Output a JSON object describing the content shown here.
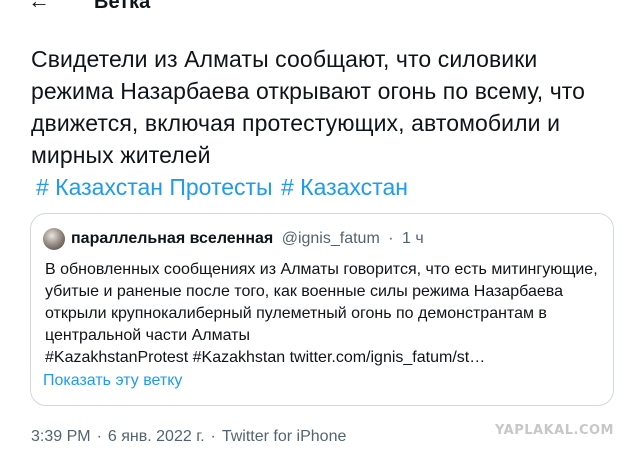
{
  "header": {
    "back_icon": "←",
    "title": "Ветка"
  },
  "tweet": {
    "text": "Свидетели из Алматы сообщают, что силовики режима Назарбаева открывают огонь по всему, что движется, включая протестующих, автомобили и мирных жителей",
    "hashtags": [
      "# Казахстан Протесты",
      "# Казахстан"
    ]
  },
  "quote": {
    "display_name": "параллельная вселенная",
    "handle": "@ignis_fatum",
    "separator": "·",
    "time": "1 ч",
    "text": "В обновленных сообщениях из Алматы говорится, что есть митингующие, убитые и раненые после того, как военные силы режима Назарбаева открыли крупнокалиберный пулеметный огонь по демонстрантам в центральной части Алматы",
    "tags_and_link": "#KazakhstanProtest #Kazakhstan twitter.com/ignis_fatum/st…",
    "show_thread": "Показать эту ветку"
  },
  "meta": {
    "time": "3:39 PM",
    "date": "6 янв. 2022 г.",
    "source": "Twitter for iPhone",
    "separator": "·"
  },
  "watermark": "YAPLAKAL.COM"
}
